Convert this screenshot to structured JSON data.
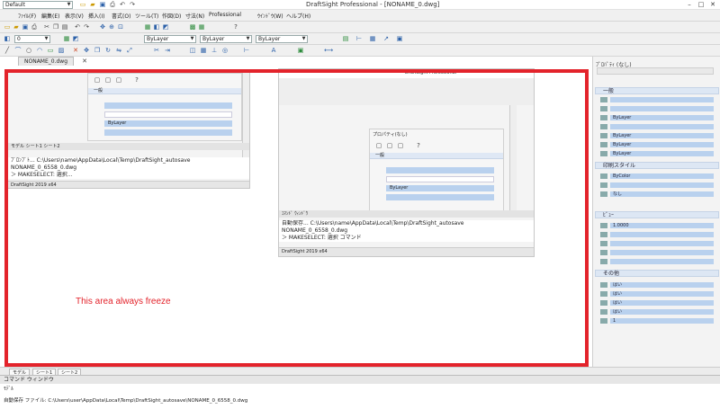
{
  "titlebar": {
    "app_title": "DraftSight Professional - [NONAME_0.dwg]",
    "workspace_combo": "Default",
    "minimize": "–",
    "maximize": "□",
    "close": "✕"
  },
  "menubar": {
    "items": [
      "ﾌｧｲﾙ(F)",
      "編集(E)",
      "表示(V)",
      "挿入(I)",
      "書式(O)",
      "ツール(T)",
      "作図(D)",
      "寸法(N)",
      "修正(M)",
      "Professional",
      "ｳｲﾝﾄﾞｳ(W)",
      "ヘルプ(H)"
    ]
  },
  "toolbar_layer": {
    "layer_combo": "0",
    "color_combo": "ByLayer",
    "linetype_combo": "ByLayer",
    "lineweight_combo": "ByLayer"
  },
  "document_tab": {
    "label": "NONAME_0.dwg"
  },
  "overlay": {
    "note": "This area always freeze"
  },
  "mini_left": {
    "section": "一般",
    "field": "ByLayer",
    "cmd1": "ﾌﾟﾛﾝﾌﾟﾄ... C:\\Users\\name\\AppData\\Local\\Temp\\DraftSight_autosave",
    "cmd2": "NONAME_0_6558_0.dwg",
    "cmd3": "＞ MAKESELECT: 選択...",
    "tabs": "モデル  シート1  シート2",
    "status": "DraftSight 2019 x64"
  },
  "mini_right": {
    "title": "DraftSight Professional",
    "palette_title": "プロパティ(なし)",
    "section": "一般",
    "field": "ByLayer",
    "cmd_title": "ｺﾏﾝﾄﾞ ｳｨﾝﾄﾞｳ",
    "cmd1": "自動保存... C:\\Users\\name\\AppData\\Local\\Temp\\DraftSight_autosave",
    "cmd2": "NONAME_0_6558_0.dwg",
    "cmd3": "＞ MAKESELECT: 選択 コマンド",
    "status": "DraftSight 2019 x64"
  },
  "properties_panel": {
    "title": "ﾌﾟﾛﾊﾟﾃｨ (なし)",
    "sections": [
      {
        "name": "一般",
        "rows": [
          "",
          "",
          "ByLayer",
          "",
          "ByLayer",
          "ByLayer",
          "ByLayer"
        ]
      },
      {
        "name": "印刷スタイル",
        "rows": [
          "ByColor",
          "",
          "なし"
        ]
      },
      {
        "name": "ﾋﾞｭｰ",
        "rows": [
          "1.0000",
          "",
          "",
          "",
          ""
        ]
      },
      {
        "name": "その他",
        "rows": [
          "はい",
          "はい",
          "はい",
          "はい",
          "1"
        ]
      }
    ]
  },
  "model_tabs": {
    "tabs": [
      "モデル",
      "シート1",
      "シート2"
    ]
  },
  "command_window": {
    "title": "コマンド ウィンドウ",
    "line1": "ﾓﾃﾞﾙ",
    "line2": "自動保存 ファイル: C:\\Users\\user\\AppData\\Local\\Temp\\DraftSight_autosave\\NONAME_0_6558_0.dwg"
  }
}
